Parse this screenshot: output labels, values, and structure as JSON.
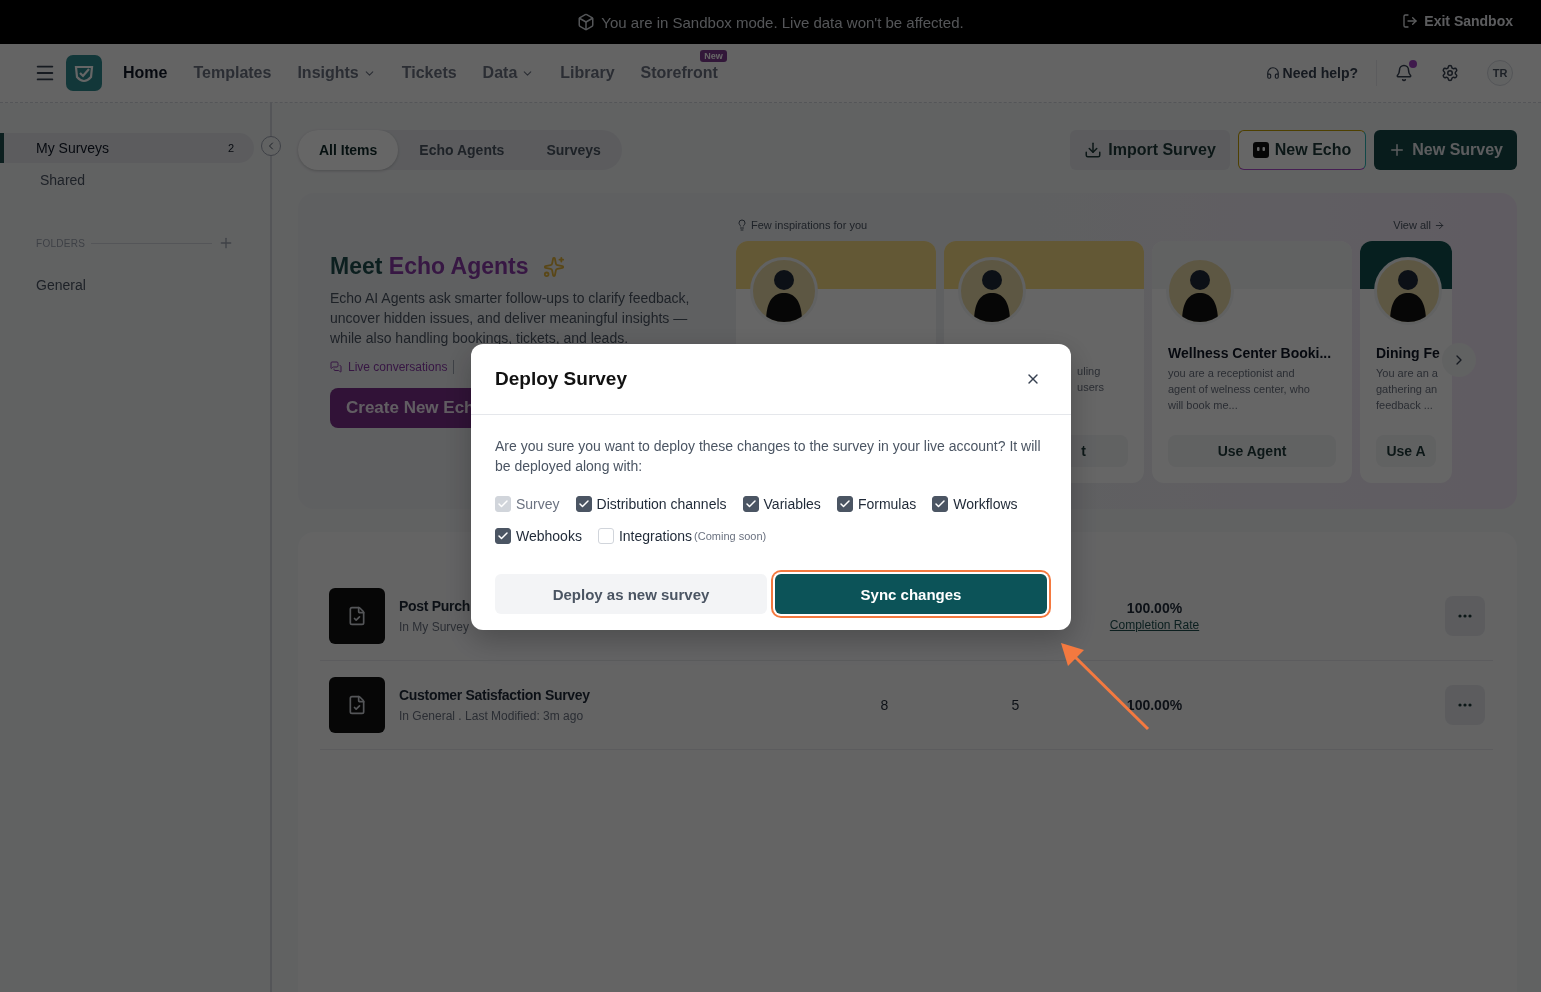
{
  "banner": {
    "message": "You are in Sandbox mode. Live data won't be affected.",
    "exit_label": "Exit Sandbox"
  },
  "nav": {
    "items": [
      {
        "label": "Home",
        "selected": true,
        "dropdown": false
      },
      {
        "label": "Templates",
        "selected": false,
        "dropdown": false
      },
      {
        "label": "Insights",
        "selected": false,
        "dropdown": true
      },
      {
        "label": "Tickets",
        "selected": false,
        "dropdown": false
      },
      {
        "label": "Data",
        "selected": false,
        "dropdown": true
      },
      {
        "label": "Library",
        "selected": false,
        "dropdown": false
      },
      {
        "label": "Storefront",
        "selected": false,
        "dropdown": false,
        "badge": "New"
      }
    ],
    "help": "Need help?",
    "notification_dot": true,
    "avatar": "TR"
  },
  "sidebar": {
    "items": [
      {
        "label": "My Surveys",
        "count": "2",
        "selected": true
      },
      {
        "label": "Shared",
        "selected": false
      }
    ],
    "folders_heading": "FOLDERS",
    "folders": [
      {
        "label": "General"
      }
    ]
  },
  "tabs": [
    {
      "label": "All Items",
      "selected": true
    },
    {
      "label": "Echo Agents",
      "selected": false
    },
    {
      "label": "Surveys",
      "selected": false
    }
  ],
  "actions": [
    {
      "kind": "import",
      "label": "Import Survey"
    },
    {
      "kind": "echo",
      "label": "New Echo"
    },
    {
      "kind": "primary",
      "label": "New Survey"
    }
  ],
  "hero": {
    "title_lead": "Meet",
    "title_accent": "Echo Agents",
    "description": "Echo AI Agents ask smarter follow-ups to clarify feedback, uncover hidden issues, and deliver meaningful insights — while also handling bookings, tickets, and leads.",
    "link": "Live conversations",
    "cta": "Create New Ech"
  },
  "inspirations": {
    "heading": "Few inspirations for you",
    "view_all": "View all",
    "cards": [
      {
        "kind": "gold"
      },
      {
        "kind": "gold",
        "lines": [
          "uling",
          "users"
        ],
        "button": "t"
      },
      {
        "kind": "plain",
        "title": "Wellness Center Booki...",
        "lines": [
          "you are a receptionist and",
          "agent of welness center, who",
          "will book me..."
        ],
        "button": "Use Agent"
      },
      {
        "kind": "teal",
        "title": "Dining Fe",
        "lines": [
          "You are an a",
          "gathering an",
          "feedback ..."
        ],
        "button": "Use A"
      }
    ]
  },
  "surveys": [
    {
      "title": "Post Purch",
      "meta": "In My Survey",
      "rate": "100.00%",
      "rate_label": "Completion Rate"
    },
    {
      "title": "Customer Satisfaction Survey",
      "meta": "In General . Last Modified: 3m ago",
      "column_1": "8",
      "column_2": "5",
      "rate": "100.00%"
    }
  ],
  "modal": {
    "title": "Deploy Survey",
    "message": "Are you sure you want to deploy these changes to the survey in your live account? It will be deployed along with:",
    "options": [
      {
        "label": "Survey",
        "checked": true,
        "disabled": true
      },
      {
        "label": "Distribution channels",
        "checked": true,
        "disabled": false
      },
      {
        "label": "Variables",
        "checked": true,
        "disabled": false
      },
      {
        "label": "Formulas",
        "checked": true,
        "disabled": false
      },
      {
        "label": "Workflows",
        "checked": true,
        "disabled": false
      },
      {
        "label": "Webhooks",
        "checked": true,
        "disabled": false
      },
      {
        "label": "Integrations",
        "checked": false,
        "disabled": false,
        "note": "(Coming soon)"
      }
    ],
    "buttons": [
      {
        "kind": "secondary",
        "label": "Deploy as new survey",
        "highlighted": false
      },
      {
        "kind": "primary",
        "label": "Sync changes",
        "highlighted": true
      }
    ]
  },
  "annotation_arrow": true
}
